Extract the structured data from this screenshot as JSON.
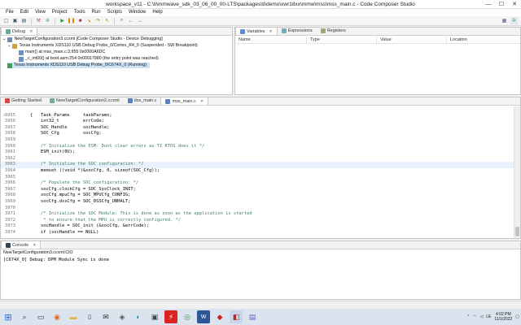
{
  "window": {
    "title": "workspace_v11 - C:\\ti\\mmwave_sdk_03_06_00_00-LTS\\packages\\ti\\demo\\xwr18xx\\mmw\\mss\\mss_main.c - Code Composer Studio",
    "minimize": "—",
    "maximize": "☐",
    "close": "✕"
  },
  "menu": [
    "File",
    "Edit",
    "View",
    "Project",
    "Tools",
    "Run",
    "Scripts",
    "Window",
    "Help"
  ],
  "debug_panel": {
    "tab_label": "Debug",
    "tree": [
      {
        "text": "NewTargetConfiguration3.ccxml [Code Composer Studio - Device Debugging]"
      },
      {
        "text": "Texas Instruments XDS110 USB Debug Probe_0/Cortex_R4_0 (Suspended - SW Breakpoint)"
      },
      {
        "text": "main() at mss_main.c:3,955 0x0000A6DC"
      },
      {
        "text": "_c_int00() at boot.asm:254 0x00017980  (the entry point was reached)"
      },
      {
        "text": "Texas Instruments XDS110 USB Debug Probe_0/C674X_0 (Running)"
      }
    ]
  },
  "variables_panel": {
    "tabs": [
      "Variables",
      "Expressions",
      "Registers"
    ],
    "columns": [
      "Name",
      "Type",
      "Value",
      "Location"
    ]
  },
  "editor": {
    "tabs": [
      "Getting Started",
      "NewTargetConfiguration2.ccxml",
      "dss_main.c",
      "mss_main.c"
    ],
    "active_tab": 3,
    "top_line_fragment": "{",
    "lines": [
      {
        "n": "3955",
        "code": "    Task_Params     taskParams;"
      },
      {
        "n": "3956",
        "code": "    int32_t         errCode;"
      },
      {
        "n": "3957",
        "code": "    SOC_Handle      socHandle;"
      },
      {
        "n": "3958",
        "code": "    SOC_Cfg         socCfg;"
      },
      {
        "n": "3959",
        "code": ""
      },
      {
        "n": "3960",
        "code": "    /* Initialize the ESM: Dont clear errors as TI RTOS does it */"
      },
      {
        "n": "3961",
        "code": "    ESM_init(0U);"
      },
      {
        "n": "3962",
        "code": ""
      },
      {
        "n": "3963",
        "code": "    /* Initialize the SOC configuration: */"
      },
      {
        "n": "3964",
        "code": "    memset ((void *)&socCfg, 0, sizeof(SOC_Cfg));"
      },
      {
        "n": "3965",
        "code": ""
      },
      {
        "n": "3966",
        "code": "    /* Populate the SOC configuration: */"
      },
      {
        "n": "3967",
        "code": "    socCfg.clockCfg = SOC_SysClock_INIT;"
      },
      {
        "n": "3968",
        "code": "    socCfg.mpuCfg = SOC_MPUCfg_CONFIG;"
      },
      {
        "n": "3969",
        "code": "    socCfg.dssCfg = SOC_DSSCfg_UNHALT;"
      },
      {
        "n": "3970",
        "code": ""
      },
      {
        "n": "3971",
        "code": "    /* Initialize the SOC Module: This is done as soon as the application is started"
      },
      {
        "n": "3972",
        "code": "     * to ensure that the MPU is correctly configured. */"
      },
      {
        "n": "3973",
        "code": "    socHandle = SOC_init (&socCfg, &errCode);"
      },
      {
        "n": "3974",
        "code": "    if (socHandle == NULL)"
      }
    ]
  },
  "console": {
    "tab_label": "Console",
    "subtitle": "NewTargetConfiguration3.ccxml:CIO",
    "output": "[C674X_0] Debug: DPM Module Sync is done"
  },
  "taskbar": {
    "tray_lang": "LE",
    "time": "4:02 PM",
    "date": "11/1/2022"
  }
}
